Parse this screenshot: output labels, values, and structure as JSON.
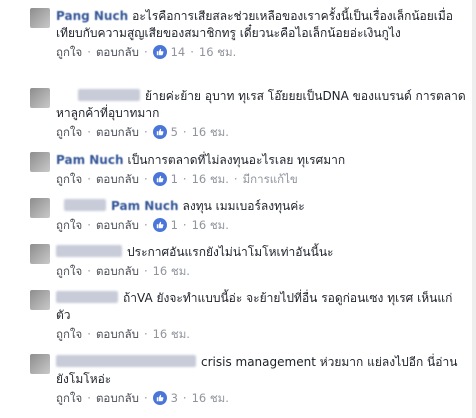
{
  "comments": [
    {
      "name": "Pang Nuch",
      "text": "อะไรคือการเสียสละช่วยเหลือของเราครั้งนี้เป็นเรื่องเล็กน้อยเมื่อเทียบกับความสูญเสียของสมาชิกทรู เดี๋ยวนะคือไอเล็กน้อยอ่ะเงินกูไง",
      "like": "ถูกใจ",
      "reply": "ตอบกลับ",
      "reactions": "14",
      "time": "16 ชม."
    },
    {
      "name": "",
      "text": "ย้ายค่ะย้าย อุบาท ทุเรส โอ๊ยยยเป็นDNA ของแบรนด์ การตลาดหาลูกค้าที่อุบาทมาก",
      "like": "ถูกใจ",
      "reply": "ตอบกลับ",
      "reactions": "5",
      "time": "16 ชม."
    },
    {
      "name": "Pam Nuch",
      "text": "เป็นการตลาดที่ไม่ลงทุนอะไรเลย ทุเรศมาก",
      "like": "ถูกใจ",
      "reply": "ตอบกลับ",
      "reactions": "1",
      "time": "16 ชม.",
      "edited": "มีการแก้ไข"
    },
    {
      "name": "Pam Nuch",
      "text": "ลงทุน เมมเบอร์ลงทุนค่ะ",
      "like": "ถูกใจ",
      "reply": "ตอบกลับ",
      "reactions": "1",
      "time": "16 ชม."
    },
    {
      "name": "",
      "text": "ประกาศอันแรกยังไม่น่าโมโหเท่าอันนี้นะ",
      "like": "ถูกใจ",
      "reply": "ตอบกลับ",
      "reactions": "",
      "time": "16 ชม."
    },
    {
      "name": "",
      "text": "ถ้าVA ยังจะทำแบบนี้อ่ะ จะย้ายไปที่อื่น รอดูก่อนเซง ทุเรศ เห็นแก่ตัว",
      "like": "ถูกใจ",
      "reply": "ตอบกลับ",
      "reactions": "",
      "time": "16 ชม."
    },
    {
      "name": "",
      "text": "crisis management ห่วยมาก แย่ลงไปอีก นี่อ่านยังโมโหอ่ะ",
      "like": "ถูกใจ",
      "reply": "ตอบกลับ",
      "reactions": "3",
      "time": "16 ชม."
    }
  ],
  "colors": {
    "link": "#4b4f56",
    "meta": "#90949c",
    "text": "#1d2129",
    "like_blue": "#4a76d9"
  }
}
